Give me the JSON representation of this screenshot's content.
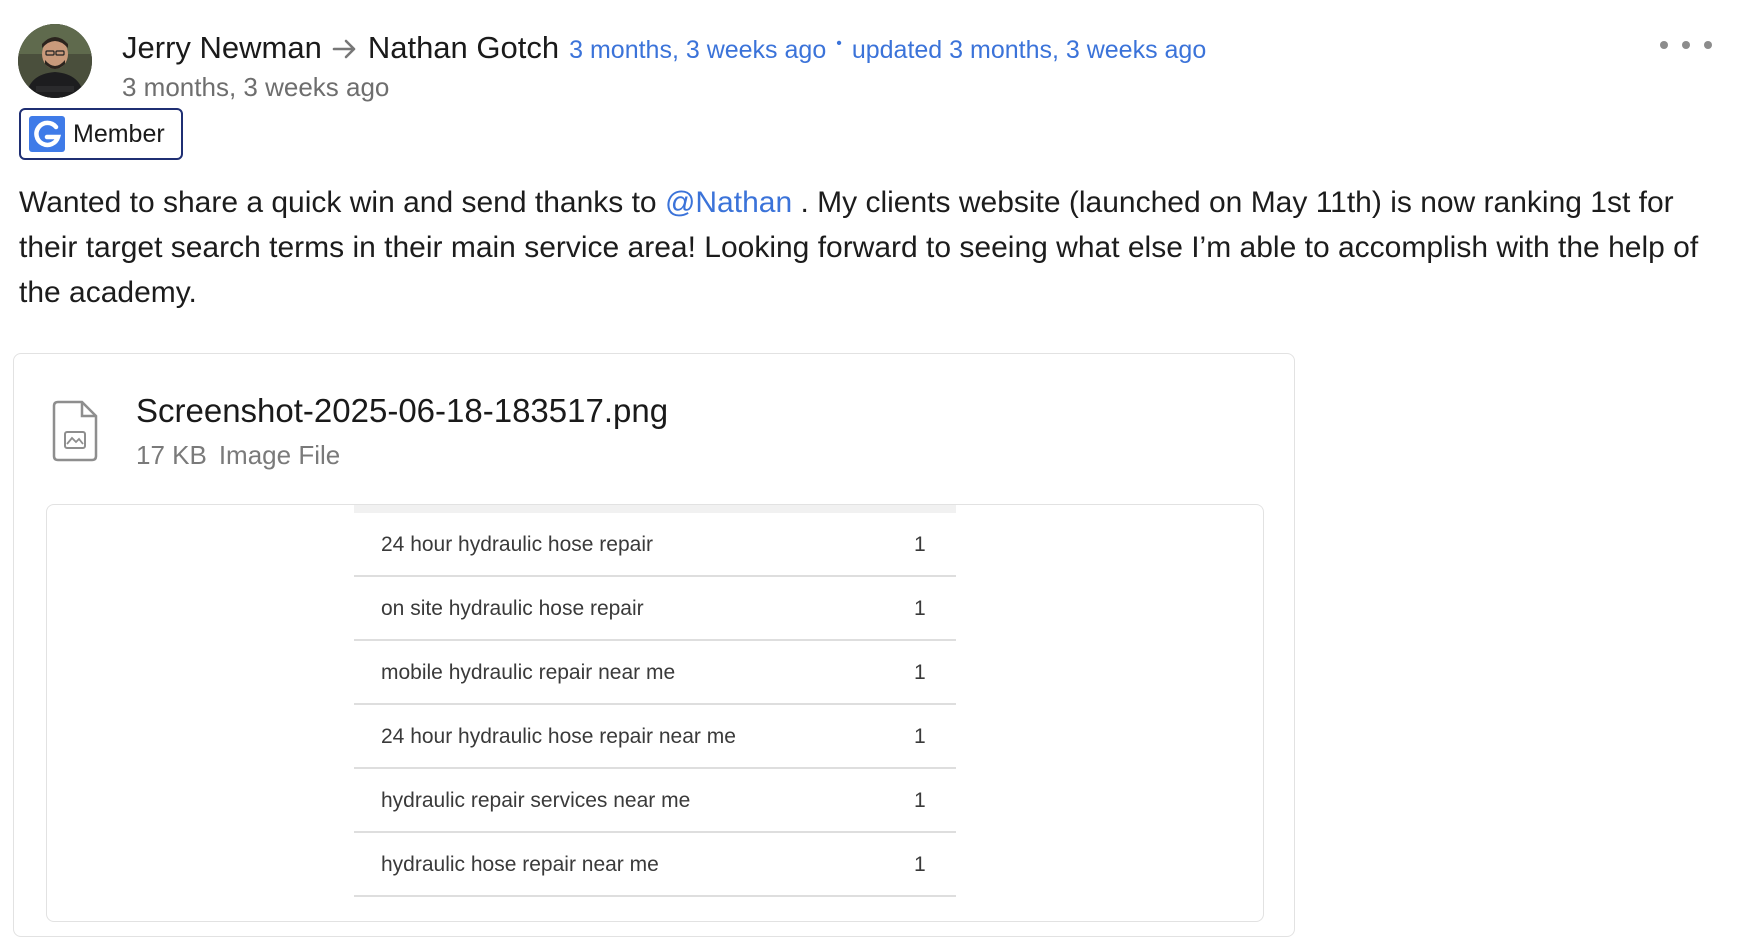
{
  "post": {
    "author": "Jerry Newman",
    "recipient": "Nathan Gotch",
    "posted_ago": "3 months, 3 weeks ago",
    "updated_label": "updated 3 months, 3 weeks ago",
    "subtime": "3 months, 3 weeks ago",
    "badge_label": "Member",
    "body_before_mention": "Wanted to share a quick win and send thanks to ",
    "mention": "@Nathan",
    "body_after_mention": " . My clients website (launched on May 11th) is now ranking 1st for their target search terms in their main service area! Looking forward to seeing what else I’m able to accomplish with the help of the academy."
  },
  "attachment": {
    "file_name": "Screenshot-2025-06-18-183517.png",
    "size": "17 KB",
    "type": "Image File"
  },
  "preview": {
    "rows": [
      {
        "keyword": "24 hour hydraulic hose repair",
        "rank": "1"
      },
      {
        "keyword": "on site hydraulic hose repair",
        "rank": "1"
      },
      {
        "keyword": "mobile hydraulic repair near me",
        "rank": "1"
      },
      {
        "keyword": "24 hour hydraulic hose repair near me",
        "rank": "1"
      },
      {
        "keyword": "hydraulic repair services near me",
        "rank": "1"
      },
      {
        "keyword": "hydraulic hose repair near me",
        "rank": "1"
      }
    ]
  },
  "colors": {
    "link": "#3b73d9",
    "badge_border": "#1f2f73",
    "text": "#1c1c1c",
    "muted": "#6e6e6e"
  },
  "icons": [
    "user-avatar",
    "right-arrow-icon",
    "more-options-icon",
    "brand-logo-icon",
    "image-file-icon"
  ]
}
